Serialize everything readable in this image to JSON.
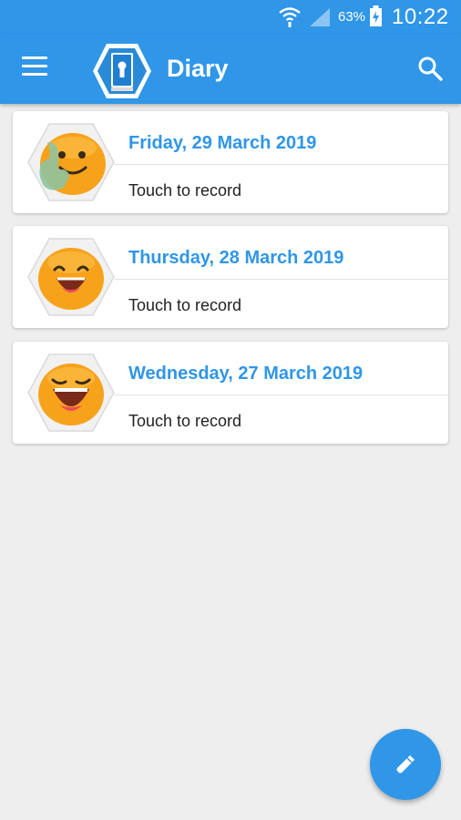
{
  "status_bar": {
    "battery_percent": "63%",
    "time": "10:22",
    "icons": [
      "wifi-icon",
      "signal-icon",
      "battery-charging-icon"
    ]
  },
  "app_bar": {
    "title": "Diary",
    "icons": [
      "menu-icon",
      "diary-lock-logo",
      "search-icon"
    ]
  },
  "entries": [
    {
      "date": "Friday, 29 March 2019",
      "subtitle": "Touch to record",
      "mood_icon": "thumbs-up-face-icon"
    },
    {
      "date": "Thursday, 28 March 2019",
      "subtitle": "Touch to record",
      "mood_icon": "happy-face-icon"
    },
    {
      "date": "Wednesday, 27 March 2019",
      "subtitle": "Touch to record",
      "mood_icon": "laughing-face-icon"
    }
  ],
  "fab": {
    "icon": "pencil-icon"
  },
  "colors": {
    "primary": "#2f96e8",
    "background": "#eeeeee",
    "emoji_orange": "#f7a21b"
  }
}
